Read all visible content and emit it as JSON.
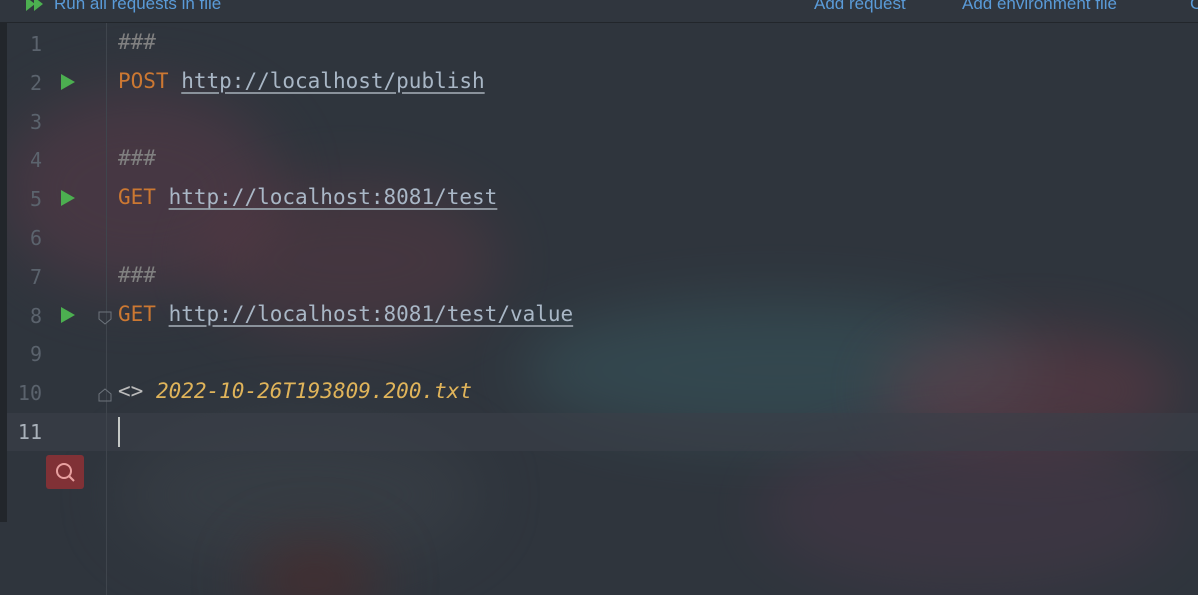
{
  "toolbar": {
    "run_all_label": "Run all requests in file",
    "add_request_label": "Add request",
    "add_environment_label": "Add environment file",
    "edge_label": "C"
  },
  "editor": {
    "lines": [
      {
        "number": "1",
        "separator": "###"
      },
      {
        "number": "2",
        "method": "POST",
        "url": "http://localhost/publish"
      },
      {
        "number": "3"
      },
      {
        "number": "4",
        "separator": "###"
      },
      {
        "number": "5",
        "method": "GET",
        "url": "http://localhost:8081/test"
      },
      {
        "number": "6"
      },
      {
        "number": "7",
        "separator": "###"
      },
      {
        "number": "8",
        "method": "GET",
        "url": "http://localhost:8081/test/value"
      },
      {
        "number": "9"
      },
      {
        "number": "10",
        "redirect": "<>",
        "response_file": "2022-10-26T193809.200.txt"
      },
      {
        "number": "11"
      }
    ]
  },
  "colors": {
    "background": "#2f353d",
    "method": "#cc7832",
    "separator": "#808080",
    "response_file": "#e0b45a",
    "run_icon": "#4caf50",
    "toolbar_link": "#5a9bd8"
  },
  "icons": [
    "run-all-icon",
    "run-request-icon",
    "fold-icon",
    "search-icon"
  ]
}
